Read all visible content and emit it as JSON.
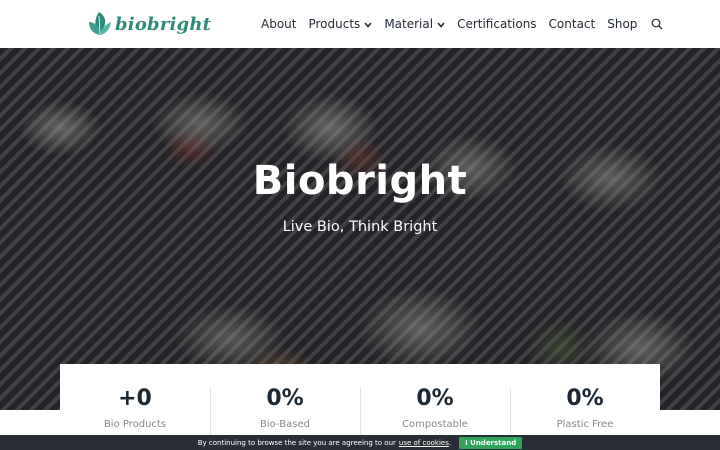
{
  "brand": {
    "name": "biobright",
    "color": "#2f8a7c"
  },
  "nav": {
    "items": [
      {
        "label": "About",
        "has_dropdown": false
      },
      {
        "label": "Products",
        "has_dropdown": true
      },
      {
        "label": "Material",
        "has_dropdown": true
      },
      {
        "label": "Certifications",
        "has_dropdown": false
      },
      {
        "label": "Contact",
        "has_dropdown": false
      },
      {
        "label": "Shop",
        "has_dropdown": false
      }
    ],
    "search_icon": "search-icon"
  },
  "hero": {
    "title": "Biobright",
    "subtitle": "Live Bio, Think Bright"
  },
  "stats": [
    {
      "value": "+0",
      "label": "Bio Products"
    },
    {
      "value": "0%",
      "label": "Bio-Based"
    },
    {
      "value": "0%",
      "label": "Compostable"
    },
    {
      "value": "0%",
      "label": "Plastic Free"
    }
  ],
  "cookie": {
    "text": "By continuing to browse the site you are agreeing to our",
    "link": "use of cookies",
    "suffix": ".",
    "button": "I Understand",
    "button_color": "#2fa55a"
  }
}
